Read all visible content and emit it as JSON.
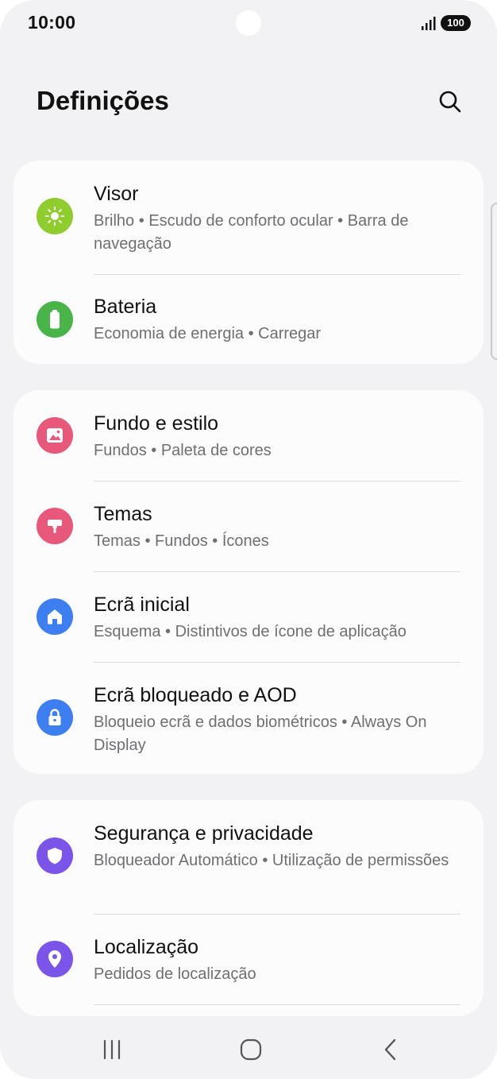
{
  "status_bar": {
    "time": "10:00",
    "battery": "100"
  },
  "header": {
    "title": "Definições"
  },
  "groups": [
    {
      "items": [
        {
          "title": "Visor",
          "subtitle": "Brilho • Escudo de conforto ocular • Barra de navegação",
          "icon": "sun-icon",
          "color": "#8fcc2e"
        },
        {
          "title": "Bateria",
          "subtitle": "Economia de energia • Carregar",
          "icon": "battery-icon",
          "color": "#49b548"
        }
      ]
    },
    {
      "items": [
        {
          "title": "Fundo e estilo",
          "subtitle": "Fundos • Paleta de cores",
          "icon": "image-icon",
          "color": "#e8587a"
        },
        {
          "title": "Temas",
          "subtitle": "Temas • Fundos • Ícones",
          "icon": "paint-roller-icon",
          "color": "#e8587a"
        },
        {
          "title": "Ecrã inicial",
          "subtitle": "Esquema • Distintivos de ícone de aplicação",
          "icon": "home-icon",
          "color": "#3d7ff0"
        },
        {
          "title": "Ecrã bloqueado e AOD",
          "subtitle": "Bloqueio ecrã e dados biométricos • Always On Display",
          "icon": "lock-icon",
          "color": "#3d7ff0"
        }
      ]
    },
    {
      "items": [
        {
          "title": "Segurança e privacidade",
          "subtitle": "Bloqueador Automático • Utilização de permissões",
          "icon": "shield-icon",
          "color": "#7b55ea"
        },
        {
          "title": "Localização",
          "subtitle": "Pedidos de localização",
          "icon": "location-pin-icon",
          "color": "#7b55ea"
        }
      ]
    }
  ],
  "nav": {
    "recents": "recents-icon",
    "home": "home-button-icon",
    "back": "back-icon"
  }
}
